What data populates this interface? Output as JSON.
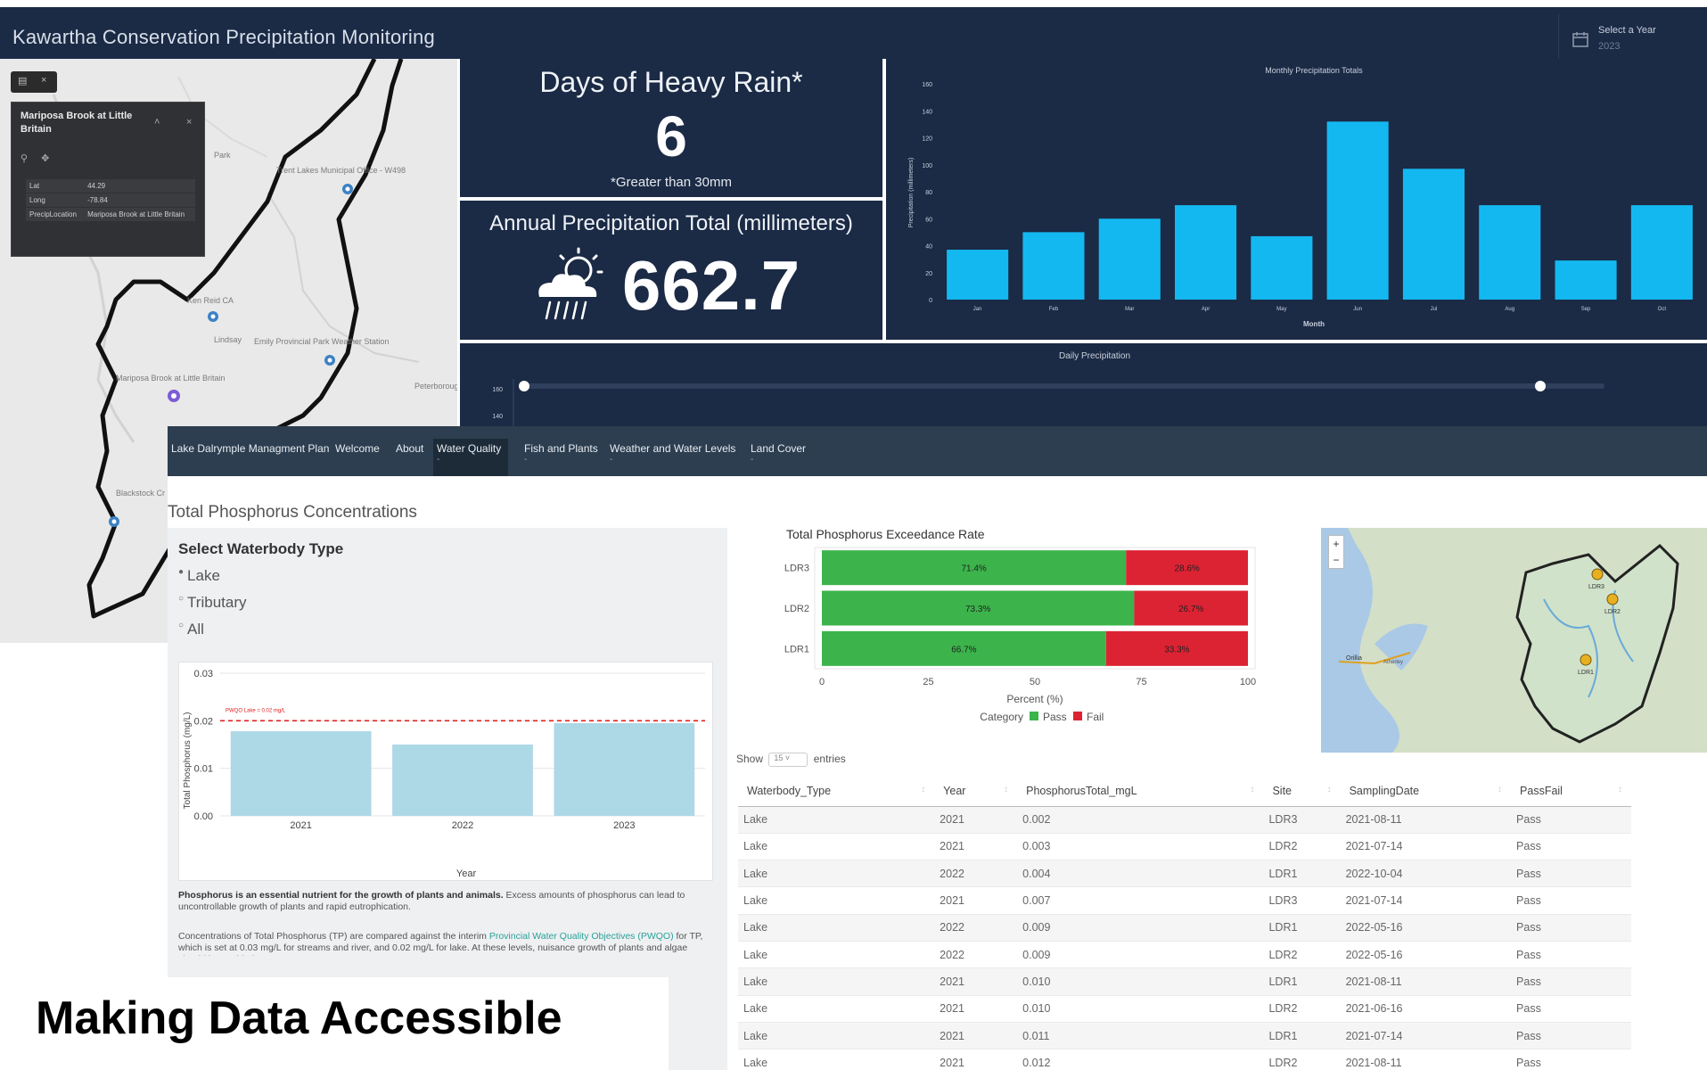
{
  "dashboard": {
    "title": "Kawartha Conservation Precipitation Monitoring",
    "year_selector": {
      "label": "Select a Year",
      "value": "2023"
    },
    "map": {
      "labels": [
        "Trent Lakes Municipal Office - W498",
        "Ken Reid CA",
        "Emily Provincial Park Weather Station",
        "Mariposa Brook at Little Britain",
        "Blackstock Cr",
        "Lindsay",
        "Peterborough",
        "Park"
      ],
      "popup": {
        "title": "Mariposa Brook at Little Britain",
        "rows": [
          {
            "key": "Lat",
            "value": "44.29"
          },
          {
            "key": "Long",
            "value": "-78.84"
          },
          {
            "key": "PrecipLocation",
            "value": "Mariposa Brook at Little Britain"
          }
        ]
      }
    },
    "heavy_rain": {
      "title": "Days of Heavy Rain*",
      "value": "6",
      "note": "*Greater than 30mm"
    },
    "annual": {
      "title": "Annual Precipitation Total (millimeters)",
      "value": "662.7"
    },
    "monthly_chart": {
      "type": "bar",
      "title": "Monthly Precipitation Totals",
      "xlabel": "Month",
      "ylabel": "Precipitation (millimeters)",
      "ylim": [
        0,
        160
      ],
      "yticks": [
        0,
        20,
        40,
        60,
        80,
        100,
        120,
        140,
        160
      ],
      "categories": [
        "Jan",
        "Feb",
        "Mar",
        "Apr",
        "May",
        "Jun",
        "Jul",
        "Aug",
        "Sep",
        "Oct"
      ],
      "values": [
        37,
        50,
        60,
        70,
        47,
        132,
        97,
        70,
        29,
        70
      ],
      "color": "#14b8f0"
    },
    "daily_chart": {
      "title": "Daily Precipitation",
      "yticks": [
        "160",
        "140"
      ]
    }
  },
  "app": {
    "nav": [
      {
        "label": "Lake Dalrymple Managment Plan",
        "active": false,
        "mark": ""
      },
      {
        "label": "Welcome",
        "active": false,
        "mark": ""
      },
      {
        "label": "About",
        "active": false,
        "mark": ""
      },
      {
        "label": "Water Quality",
        "active": true,
        "mark": "-"
      },
      {
        "label": "Fish and Plants",
        "active": false,
        "mark": "-"
      },
      {
        "label": "Weather and Water Levels",
        "active": false,
        "mark": "-"
      },
      {
        "label": "Land Cover",
        "active": false,
        "mark": "-"
      }
    ],
    "page_title": "Total Phosphorus Concentrations",
    "sidebar": {
      "label": "Select Waterbody Type",
      "options": [
        {
          "label": "Lake",
          "selected": true
        },
        {
          "label": "Tributary",
          "selected": false
        },
        {
          "label": "All",
          "selected": false
        }
      ],
      "para1_bold": "Phosphorus is an essential nutrient for the growth of plants and animals.",
      "para1_rest": " Excess amounts of phosphorus can lead to uncontrollable growth of plants and rapid eutrophication.",
      "para2_a": "Concentrations of Total Phosphorus (TP) are compared against the interim ",
      "para2_link": "Provincial Water Quality Objectives (PWQO)",
      "para2_b": " for TP, which is set at 0.03 mg/L for streams and river, and 0.02 mg/L for lake. At these levels, nuisance growth of plants and algae should be avoided."
    },
    "tp_chart": {
      "type": "bar",
      "xlabel": "Year",
      "ylabel": "Total Phosphorus (mg/L)",
      "ylim": [
        0,
        0.03
      ],
      "yticks": [
        "0.00",
        "0.01",
        "0.02",
        "0.03"
      ],
      "categories": [
        "2021",
        "2022",
        "2023"
      ],
      "values": [
        0.0178,
        0.015,
        0.0195
      ],
      "threshold": 0.02,
      "threshold_label": "PWQO Lake = 0.02 mg/L",
      "color": "#add8e6"
    },
    "exceedance_chart": {
      "type": "bar",
      "orientation": "horizontal-stacked",
      "title": "Total Phosphorus Exceedance Rate",
      "xlabel": "Percent (%)",
      "xlim": [
        0,
        100
      ],
      "xticks": [
        "0",
        "25",
        "50",
        "75",
        "100"
      ],
      "categories": [
        "LDR3",
        "LDR2",
        "LDR1"
      ],
      "series": [
        {
          "name": "Pass",
          "values": [
            71.4,
            73.3,
            66.7
          ],
          "labels": [
            "71.4%",
            "73.3%",
            "66.7%"
          ],
          "color": "#3cb44b"
        },
        {
          "name": "Fail",
          "values": [
            28.6,
            26.7,
            33.3
          ],
          "labels": [
            "28.6%",
            "26.7%",
            "33.3%"
          ],
          "color": "#dc2333"
        }
      ],
      "legend_title": "Category"
    },
    "mini_map": {
      "labels": [
        "LDR3",
        "LDR2",
        "LDR1",
        "Orillia",
        "Atherley"
      ],
      "zoom_in": "+",
      "zoom_out": "−"
    },
    "table": {
      "show_prefix": "Show",
      "show_value": "15",
      "show_suffix": "entries",
      "columns": [
        "Waterbody_Type",
        "Year",
        "PhosphorusTotal_mgL",
        "Site",
        "SamplingDate",
        "PassFail"
      ],
      "rows": [
        [
          "Lake",
          "2021",
          "0.002",
          "LDR3",
          "2021-08-11",
          "Pass"
        ],
        [
          "Lake",
          "2021",
          "0.003",
          "LDR2",
          "2021-07-14",
          "Pass"
        ],
        [
          "Lake",
          "2022",
          "0.004",
          "LDR1",
          "2022-10-04",
          "Pass"
        ],
        [
          "Lake",
          "2021",
          "0.007",
          "LDR3",
          "2021-07-14",
          "Pass"
        ],
        [
          "Lake",
          "2022",
          "0.009",
          "LDR1",
          "2022-05-16",
          "Pass"
        ],
        [
          "Lake",
          "2022",
          "0.009",
          "LDR2",
          "2022-05-16",
          "Pass"
        ],
        [
          "Lake",
          "2021",
          "0.010",
          "LDR1",
          "2021-08-11",
          "Pass"
        ],
        [
          "Lake",
          "2021",
          "0.010",
          "LDR2",
          "2021-06-16",
          "Pass"
        ],
        [
          "Lake",
          "2021",
          "0.011",
          "LDR1",
          "2021-07-14",
          "Pass"
        ],
        [
          "Lake",
          "2021",
          "0.012",
          "LDR2",
          "2021-08-11",
          "Pass"
        ]
      ]
    }
  },
  "tagline": "Making Data Accessible"
}
